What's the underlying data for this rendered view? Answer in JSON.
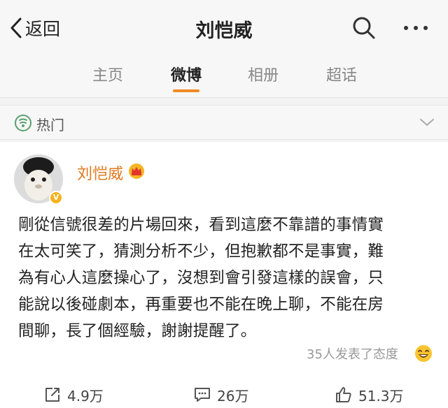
{
  "header": {
    "back_label": "返回",
    "title": "刘恺威"
  },
  "tabs": [
    {
      "label": "主页",
      "active": false
    },
    {
      "label": "微博",
      "active": true
    },
    {
      "label": "相册",
      "active": false
    },
    {
      "label": "超话",
      "active": false
    }
  ],
  "hot": {
    "label": "热门"
  },
  "post": {
    "author": "刘恺威",
    "text_lines": [
      "剛從信號很差的片場回來，看到這麼不靠譜的事情實",
      "在太可笑了，猜測分析不少，但抱歉都不是事實，難",
      "為有心人這麼操心了，沒想到會引發這樣的誤會，只",
      "能說以後碰劇本，再重要也不能在晚上聊，不能在房",
      "間聊，長了個經驗，謝謝提醒了。"
    ],
    "reactions_text": "35人发表了态度"
  },
  "actions": {
    "share_count": "4.9万",
    "comment_count": "26万",
    "like_count": "51.3万"
  },
  "colors": {
    "accent": "#f08a24",
    "author": "#e07a1f"
  }
}
